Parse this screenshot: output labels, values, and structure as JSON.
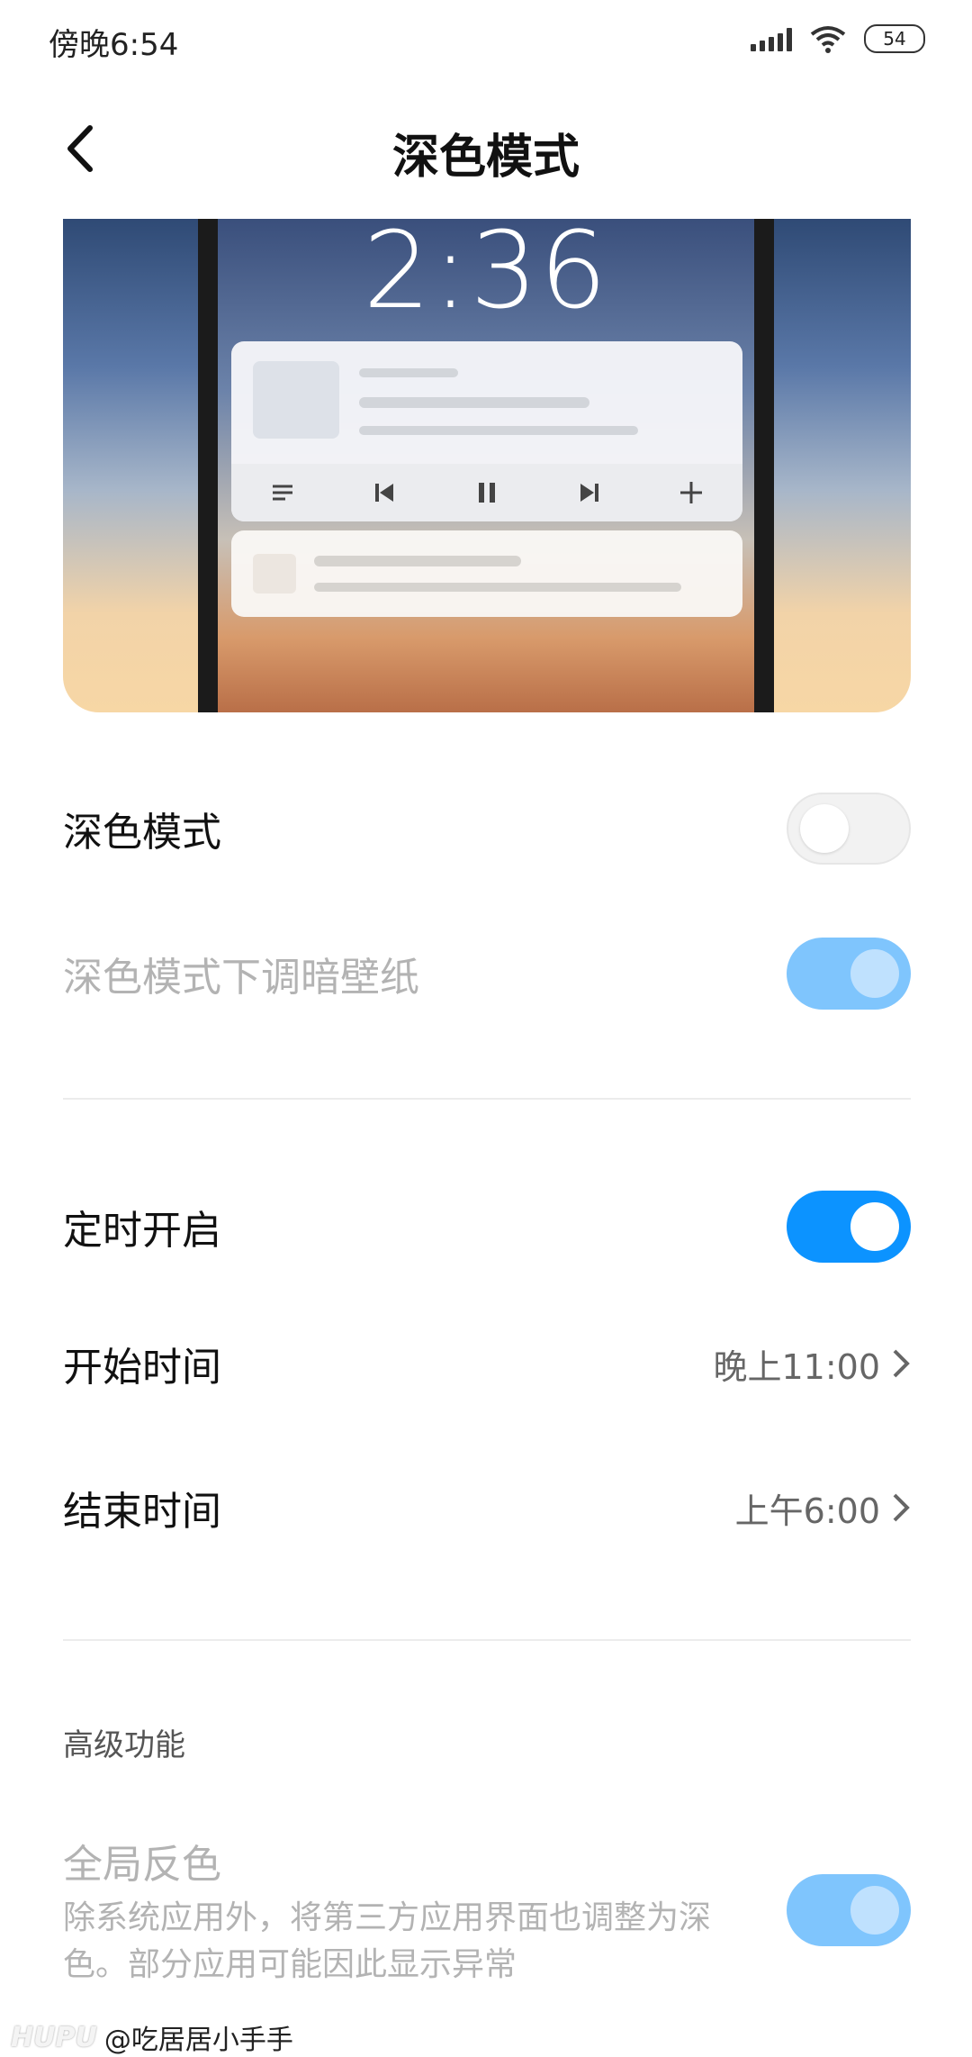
{
  "status_bar": {
    "time": "傍晚6:54",
    "battery": "54"
  },
  "header": {
    "title": "深色模式"
  },
  "preview": {
    "lock_time": "2:36"
  },
  "settings": {
    "dark_mode": {
      "label": "深色模式",
      "enabled": false
    },
    "dim_wallpaper": {
      "label": "深色模式下调暗壁纸",
      "enabled": true,
      "disabled": true
    },
    "scheduled": {
      "label": "定时开启",
      "enabled": true
    },
    "start_time": {
      "label": "开始时间",
      "value": "晚上11:00"
    },
    "end_time": {
      "label": "结束时间",
      "value": "上午6:00"
    }
  },
  "advanced": {
    "section_title": "高级功能",
    "global_invert": {
      "label": "全局反色",
      "description": "除系统应用外，将第三方应用界面也调整为深色。部分应用可能因此显示异常",
      "enabled": true,
      "disabled": true
    }
  },
  "watermark": {
    "brand": "HUPU",
    "user": "@吃居居小手手"
  },
  "colors": {
    "accent": "#0c93ff",
    "accent_disabled": "#7fc5fd",
    "text_primary": "#111111",
    "text_disabled": "#b3b3b3"
  }
}
